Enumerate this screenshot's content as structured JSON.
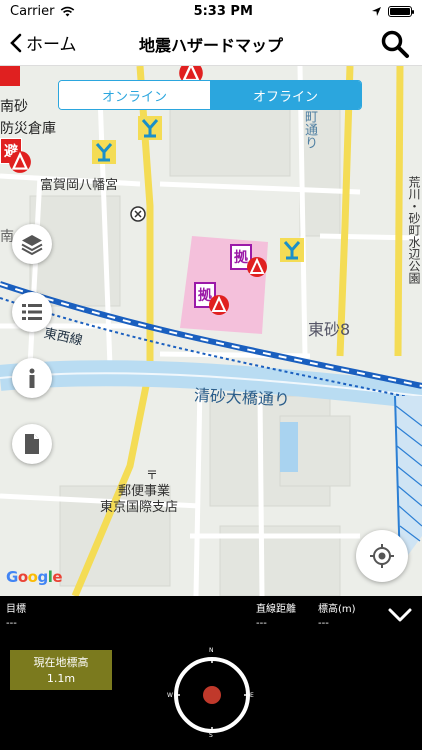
{
  "status": {
    "carrier": "Carrier",
    "time": "5:33 PM"
  },
  "nav": {
    "back_label": "ホーム",
    "title": "地震ハザードマップ"
  },
  "segment": {
    "online": "オンライン",
    "offline": "オフライン",
    "selected": "オフライン"
  },
  "map": {
    "labels": {
      "l1": "南砂",
      "l2": "防災倉庫",
      "l3": "富賀岡八幡宮",
      "l4": "町通り",
      "l5": "荒川・砂町水辺公園",
      "l6": "東砂8",
      "l7": "清砂大橋通り",
      "l8": "郵便事業",
      "l9": "東京国際支店",
      "l10": "東西線",
      "l11": "南",
      "shelter": "避",
      "base": "拠",
      "post": "〒"
    },
    "attribution": "Google"
  },
  "panel": {
    "target_label": "目標",
    "target_value": "---",
    "distance_label": "直線距離",
    "distance_value": "---",
    "elevation_label": "標高(m)",
    "elevation_value": "---",
    "current_elev_label": "現在地標高",
    "current_elev_value": "1.1m",
    "compass": {
      "n": "N",
      "e": "E",
      "s": "S",
      "w": "W"
    }
  },
  "colors": {
    "accent": "#2ba6de",
    "elevation_box": "#7b7a1e",
    "shelter_red": "#e02020"
  }
}
